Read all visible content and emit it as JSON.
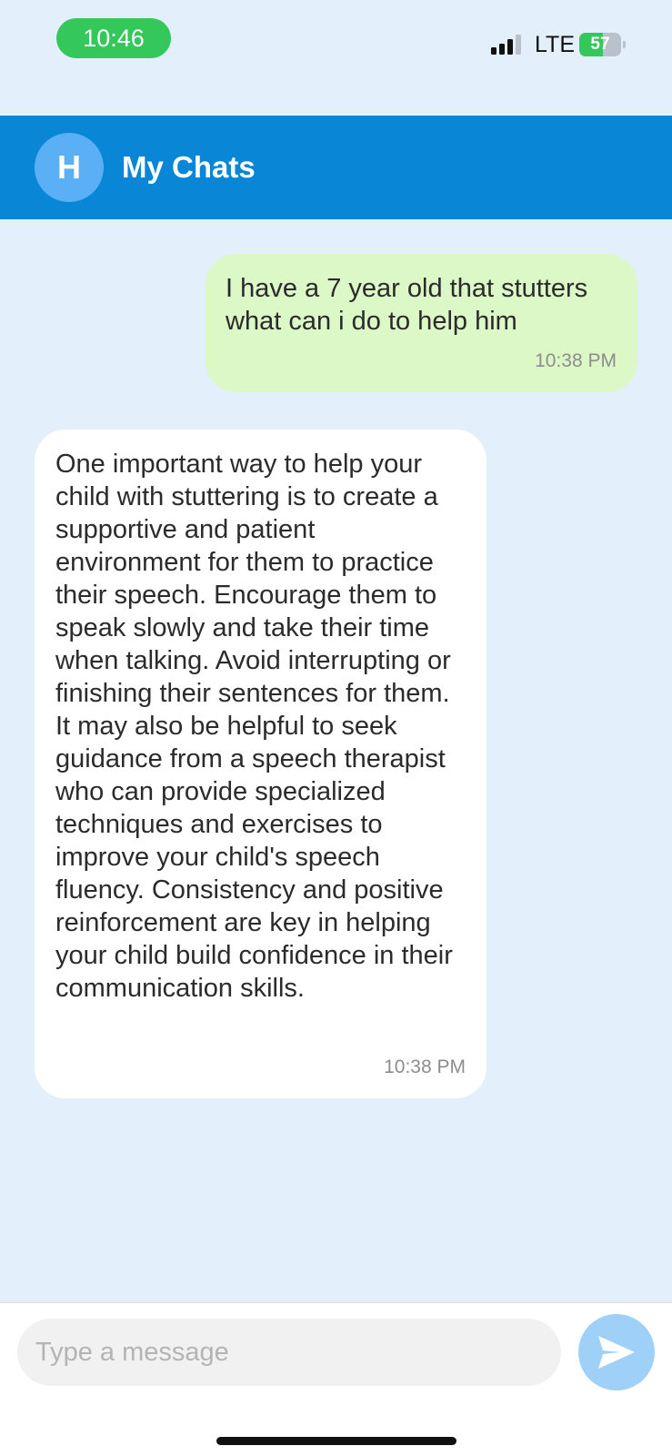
{
  "status_bar": {
    "time": "10:46",
    "network": "LTE",
    "battery_percent": "57",
    "battery_level": 0.57,
    "signal_bars_active": 3,
    "signal_bars_total": 4
  },
  "header": {
    "avatar_initial": "H",
    "title": "My Chats",
    "background_color": "#0a86d6"
  },
  "messages": [
    {
      "sender": "user",
      "text": "I have a 7 year old that stutters what can i do to help him",
      "time": "10:38 PM",
      "bubble_color": "#dcf8c6"
    },
    {
      "sender": "bot",
      "text": "One important way to help your child with stuttering is to create a supportive and patient environment for them to practice their speech. Encourage them to speak slowly and take their time when talking. Avoid interrupting or finishing their sentences for them. It may also be helpful to seek guidance from a speech therapist who can provide specialized techniques and exercises to improve your child's speech fluency. Consistency and positive reinforcement are key in helping your child build confidence in their communication skills.",
      "time": "10:38 PM",
      "bubble_color": "#ffffff"
    }
  ],
  "input_bar": {
    "placeholder": "Type a message",
    "value": "",
    "send_icon": "send-icon"
  }
}
